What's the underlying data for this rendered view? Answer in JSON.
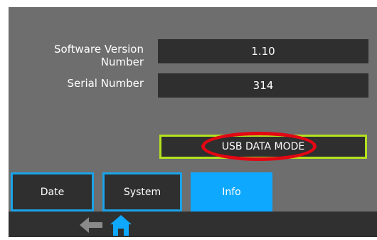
{
  "info_panel": {
    "software_version_label": "Software Version Number",
    "software_version_value": "1.10",
    "serial_number_label": "Serial Number",
    "serial_number_value": "314",
    "usb_button_label": "USB DATA MODE"
  },
  "tabs": [
    {
      "label": "Date"
    },
    {
      "label": "System"
    },
    {
      "label": "Info"
    }
  ],
  "bottom_nav": {
    "back_icon": "back-arrow-icon",
    "home_icon": "home-icon"
  },
  "colors": {
    "panel": "#6e6e6e",
    "box": "#2f2f2f",
    "accent_blue": "#1aa3e8",
    "active_tab": "#0fa8ff",
    "usb_border": "#b3e21e",
    "highlight": "#e30613"
  }
}
